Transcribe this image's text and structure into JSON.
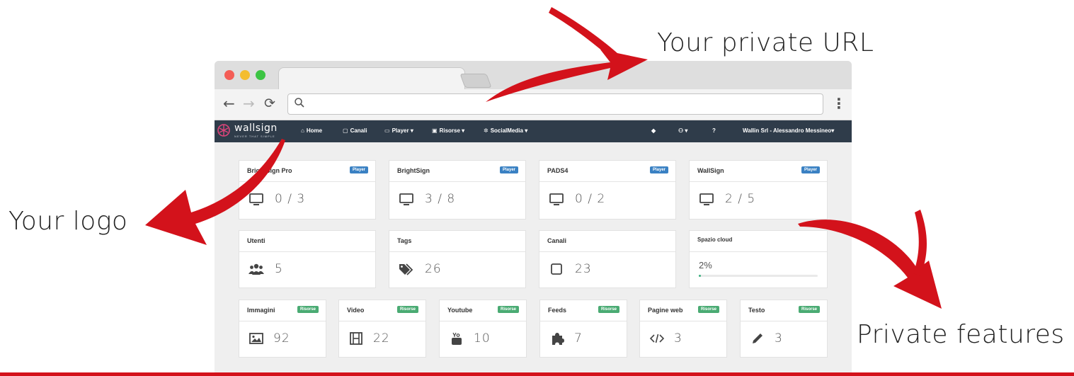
{
  "callouts": {
    "private_url": "Your private URL",
    "logo": "Your logo",
    "features": "Private features"
  },
  "browser": {
    "url_value": ""
  },
  "nav": {
    "brand_name": "wallsign",
    "brand_tagline": "NEVER THAT SIMPLE",
    "items": [
      {
        "label": "Home",
        "icon": "home-icon"
      },
      {
        "label": "Canali",
        "icon": "square-icon"
      },
      {
        "label": "Player",
        "icon": "monitor-icon"
      },
      {
        "label": "Risorse",
        "icon": "image-icon"
      },
      {
        "label": "SocialMedia",
        "icon": "gear-icon"
      }
    ],
    "right": {
      "help": "?",
      "user": "Wallin Srl - Alessandro Messineo"
    }
  },
  "player_cards": [
    {
      "title": "BrightSign Pro",
      "badge": "Player",
      "value": "0 / 3"
    },
    {
      "title": "BrightSign",
      "badge": "Player",
      "value": "3 / 8"
    },
    {
      "title": "PADS4",
      "badge": "Player",
      "value": "0 / 2"
    },
    {
      "title": "WallSign",
      "badge": "Player",
      "value": "2 / 5"
    }
  ],
  "stat_cards": [
    {
      "title": "Utenti",
      "value": "5",
      "icon": "users-icon"
    },
    {
      "title": "Tags",
      "value": "26",
      "icon": "tags-icon"
    },
    {
      "title": "Canali",
      "value": "23",
      "icon": "square-icon"
    }
  ],
  "cloud": {
    "title": "Spazio cloud",
    "percent_label": "2%",
    "fraction": 0.02
  },
  "resource_cards": [
    {
      "title": "Immagini",
      "badge": "Risorse",
      "value": "92",
      "icon": "image-icon"
    },
    {
      "title": "Video",
      "badge": "Risorse",
      "value": "22",
      "icon": "film-icon"
    },
    {
      "title": "Youtube",
      "badge": "Risorse",
      "value": "10",
      "icon": "youtube-icon"
    },
    {
      "title": "Feeds",
      "badge": "Risorse",
      "value": "7",
      "icon": "puzzle-icon"
    },
    {
      "title": "Pagine web",
      "badge": "Risorse",
      "value": "3",
      "icon": "code-icon"
    },
    {
      "title": "Testo",
      "badge": "Risorse",
      "value": "3",
      "icon": "pencil-icon"
    }
  ],
  "colors": {
    "nav_bg": "#2f3c4a",
    "player_badge": "#3a81c3",
    "risorse_badge": "#4aab73",
    "arrow_red": "#d3121b"
  }
}
